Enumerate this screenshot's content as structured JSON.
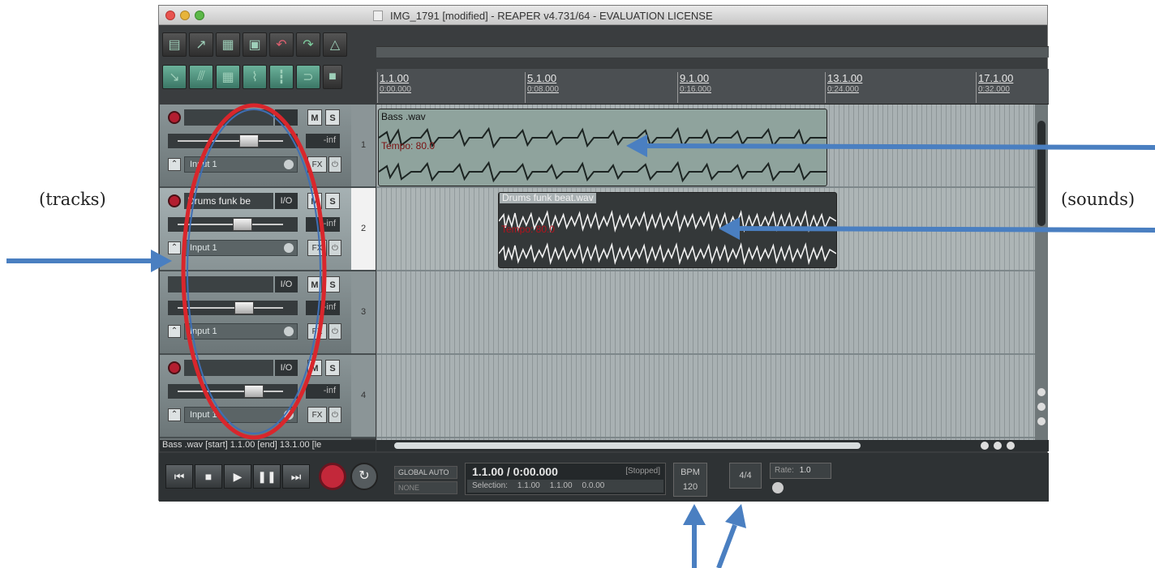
{
  "window": {
    "title": "IMG_1791 [modified] - REAPER v4.731/64 - EVALUATION LICENSE"
  },
  "annotations": {
    "tracks_label": "(tracks)",
    "sounds_label": "(sounds)"
  },
  "toolbar": {
    "row1_icons": [
      "new-project-icon",
      "open-project-icon",
      "save-project-icon",
      "project-settings-icon",
      "undo-icon",
      "redo-icon",
      "metronome-icon"
    ],
    "row2_icons": [
      "snap-icon",
      "ripple-edit-icon",
      "grid-icon",
      "envelope-lock-icon",
      "item-grouping-icon",
      "loop-icon",
      "lock-icon"
    ]
  },
  "ruler": {
    "marks": [
      {
        "bar": "1.1.00",
        "time": "0:00.000"
      },
      {
        "bar": "5.1.00",
        "time": "0:08.000"
      },
      {
        "bar": "9.1.00",
        "time": "0:16.000"
      },
      {
        "bar": "13.1.00",
        "time": "0:24.000"
      },
      {
        "bar": "17.1.00",
        "time": "0:32.000"
      }
    ]
  },
  "tracks": [
    {
      "number": "1",
      "name": "",
      "io": "",
      "mute": "M",
      "solo": "S",
      "volume": "-inf",
      "input": "Input 1",
      "fx": "FX",
      "power": "⏻"
    },
    {
      "number": "2",
      "name": "Drums funk be",
      "io": "I/O",
      "mute": "M",
      "solo": "S",
      "volume": "-inf",
      "input": "Input 1",
      "fx": "FX",
      "power": "⏻"
    },
    {
      "number": "3",
      "name": "",
      "io": "I/O",
      "mute": "M",
      "solo": "S",
      "volume": "-inf",
      "input": "Input 1",
      "fx": "FX",
      "power": "⏻"
    },
    {
      "number": "4",
      "name": "",
      "io": "I/O",
      "mute": "M",
      "solo": "S",
      "volume": "-inf",
      "input": "Input 1",
      "fx": "FX",
      "power": "⏻"
    }
  ],
  "items": [
    {
      "name": "Bass .wav",
      "tempo": "Tempo: 80.0"
    },
    {
      "name": "Drums funk beat.wav",
      "tempo": "Tempo: 80.0"
    }
  ],
  "status_bar": {
    "text": "Bass .wav [start] 1.1.00 [end] 13.1.00 [le"
  },
  "transport": {
    "buttons": [
      "go-to-start-icon",
      "stop-icon",
      "play-icon",
      "pause-icon",
      "go-to-end-icon"
    ],
    "global_auto": "GLOBAL AUTO",
    "global_auto_mode": "NONE",
    "position": "1.1.00 / 0:00.000",
    "state": "[Stopped]",
    "selection_label": "Selection:",
    "selection_start": "1.1.00",
    "selection_end": "1.1.00",
    "selection_length": "0.0.00",
    "bpm_label": "BPM",
    "bpm_value": "120",
    "time_signature": "4/4",
    "rate_label": "Rate:",
    "rate_value": "1.0"
  },
  "colors": {
    "highlight_ellipse_outer": "#d9262c",
    "highlight_ellipse_inner": "#3f6fb5",
    "arrow": "#4a7fc1",
    "record": "#c3283a"
  }
}
